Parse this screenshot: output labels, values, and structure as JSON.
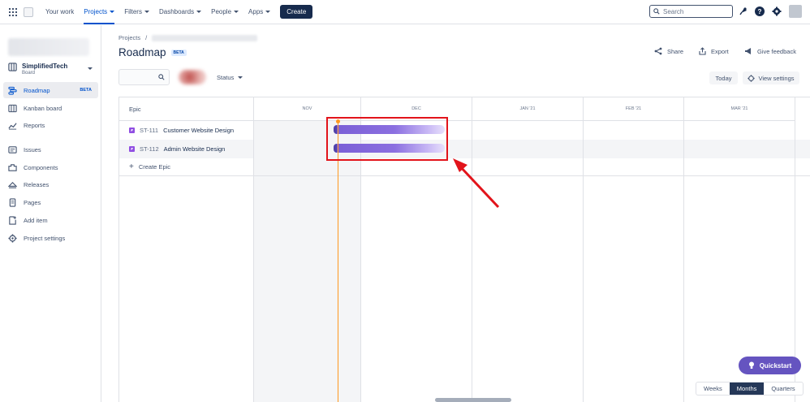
{
  "topnav": {
    "items": [
      {
        "label": "Your work",
        "has_caret": false,
        "active": false
      },
      {
        "label": "Projects",
        "has_caret": true,
        "active": true
      },
      {
        "label": "Filters",
        "has_caret": true,
        "active": false
      },
      {
        "label": "Dashboards",
        "has_caret": true,
        "active": false
      },
      {
        "label": "People",
        "has_caret": true,
        "active": false
      },
      {
        "label": "Apps",
        "has_caret": true,
        "active": false
      }
    ],
    "create_label": "Create",
    "search_placeholder": "Search",
    "icons": [
      "apps-grid-icon",
      "jira-logo",
      "notifications-icon",
      "help-icon",
      "settings-icon",
      "profile-avatar"
    ]
  },
  "sidebar": {
    "project_name": "SimplifiedTech",
    "project_type": "Board",
    "items": [
      {
        "label": "Roadmap",
        "icon": "roadmap-icon",
        "active": true,
        "badge": "BETA"
      },
      {
        "label": "Kanban board",
        "icon": "board-icon",
        "active": false
      },
      {
        "label": "Reports",
        "icon": "reports-icon",
        "active": false
      },
      {
        "label": "Issues",
        "icon": "issues-icon",
        "active": false
      },
      {
        "label": "Components",
        "icon": "components-icon",
        "active": false
      },
      {
        "label": "Releases",
        "icon": "releases-icon",
        "active": false
      },
      {
        "label": "Pages",
        "icon": "pages-icon",
        "active": false
      },
      {
        "label": "Add item",
        "icon": "add-item-icon",
        "active": false
      },
      {
        "label": "Project settings",
        "icon": "gear-icon",
        "active": false
      }
    ]
  },
  "header": {
    "breadcrumb": "Projects",
    "breadcrumb_sep": "/",
    "title": "Roadmap",
    "title_badge": "BETA",
    "share_label": "Share",
    "export_label": "Export",
    "feedback_label": "Give feedback"
  },
  "filters": {
    "status_label": "Status",
    "today_label": "Today",
    "view_settings_label": "View settings"
  },
  "roadmap": {
    "epic_header": "Epic",
    "epics": [
      {
        "key": "ST-111",
        "name": "Customer Website Design"
      },
      {
        "key": "ST-112",
        "name": "Admin Website Design"
      }
    ],
    "create_epic_label": "Create Epic",
    "months": [
      "NOV",
      "DEC",
      "JAN '21",
      "FEB '21",
      "MAR '21"
    ]
  },
  "quickstart_label": "Quickstart",
  "view_modes": {
    "weeks": "Weeks",
    "months": "Months",
    "quarters": "Quarters",
    "selected": "Months"
  },
  "colors": {
    "accent": "#0052cc",
    "epic_bar": "#8777d9",
    "today_line": "#ff991f",
    "annotation": "#e2141b",
    "quickstart": "#6554c0"
  }
}
